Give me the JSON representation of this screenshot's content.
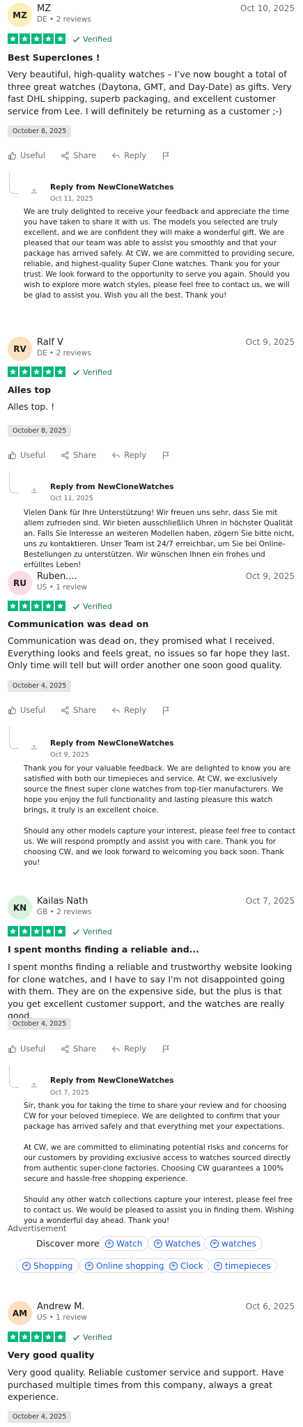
{
  "colors": {
    "star_green": "#00b67a",
    "verified_green": "#1c7a46",
    "link_blue": "#1a5bd8"
  },
  "actions": {
    "useful": "Useful",
    "share": "Share",
    "reply": "Reply"
  },
  "reviews": [
    {
      "initials": "MZ",
      "name": "MZ",
      "meta": "DE • 2 reviews",
      "date": "Oct 10, 2025",
      "rating": 5,
      "verified": "Verified",
      "title": "Best Superclones !",
      "body": "Very beautiful, high-quality watches – I’ve now bought a total of three great watches (Daytona, GMT, and Day-Date) as gifts. Very fast DHL shipping, superb packaging, and excellent customer service from Lee. I will definitely be returning as a customer ;-)",
      "experience_date": "October 8, 2025",
      "reply": {
        "from": "Reply from NewCloneWatches",
        "date": "Oct 11, 2025",
        "paragraphs": [
          "We are truly delighted to receive your feedback and appreciate the time you have taken to share it with us. The models you selected are truly excellent, and we are confident they will make a wonderful gift. We are pleased that our team was able to assist you smoothly and that your package has arrived safely. At CW, we are committed to providing secure, reliable, and highest-quality Super Clone watches. Thank you for your trust. We look forward to the opportunity to serve you again. Should you wish to explore more watch styles, please feel free to contact us, we will be glad to assist you. Wish you all the best. Thank you!"
        ]
      }
    },
    {
      "initials": "RV",
      "name": "Ralf V",
      "meta": "DE • 2 reviews",
      "date": "Oct 9, 2025",
      "rating": 5,
      "verified": "Verified",
      "title": "Alles top",
      "body": "Alles top. !",
      "experience_date": "October 8, 2025",
      "reply": {
        "from": "Reply from NewCloneWatches",
        "date": "Oct 11, 2025",
        "paragraphs": [
          "Vielen Dank für Ihre Unterstützung! Wir freuen uns sehr, dass Sie mit allem zufrieden sind. Wir bieten ausschließlich Uhren in höchster Qualität an. Falls Sie Interesse an weiteren Modellen haben, zögern Sie bitte nicht, uns zu kontaktieren. Unser Team ist 24/7 erreichbar, um Sie bei Online-Bestellungen zu unterstützen. Wir wünschen Ihnen ein frohes und erfülltes Leben!"
        ]
      }
    },
    {
      "initials": "RU",
      "name": "Ruben....",
      "meta": "US • 1 review",
      "date": "Oct 9, 2025",
      "rating": 5,
      "verified": "Verified",
      "title": "Communication was dead on",
      "body": "Communication was dead on, they promised what I received. Everything looks and feels great, no issues so far hope they last. Only time will tell but will order another one soon good quality.",
      "experience_date": "October 4, 2025",
      "reply": {
        "from": "Reply from NewCloneWatches",
        "date": "Oct 9, 2025",
        "paragraphs": [
          "Thank you for your valuable feedback. We are delighted to know you are satisfied with both our timepieces and service. At CW, we exclusively source the finest super clone watches from top-tier manufacturers. We hope you enjoy the full functionality and lasting pleasure this watch brings, it truly is an excellent choice.",
          "Should any other models capture your interest, please feel free to contact us. We will respond promptly and assist you with care. Thank you for choosing CW, and we look forward to welcoming you back soon. Thank you!"
        ]
      }
    },
    {
      "initials": "KN",
      "name": "Kailas Nath",
      "meta": "GB • 2 reviews",
      "date": "Oct 7, 2025",
      "rating": 5,
      "verified": "Verified",
      "title": "I spent months finding a reliable and...",
      "body": "I spent months finding a reliable and trustworthy website looking for clone watches, and I have to say I'm not disappointed going with them. They are on the expensive side, but the plus is that you get excellent customer support, and the watches are really good.",
      "experience_date": "October 4, 2025",
      "reply": {
        "from": "Reply from NewCloneWatches",
        "date": "Oct 7, 2025",
        "paragraphs": [
          "Sir, thank you for taking the time to share your review and for choosing CW for your beloved timepiece. We are delighted to confirm that your package has arrived safely and that everything met your expectations.",
          "At CW, we are committed to eliminating potential risks and concerns for our customers by providing exclusive access to watches sourced directly from authentic super-clone factories. Choosing CW guarantees a 100% secure and hassle-free shopping experience.",
          "Should any other watch collections capture your interest, please feel free to contact us. We would be pleased to assist you in finding them. Wishing you a wonderful day ahead. Thank you!"
        ]
      }
    },
    {
      "initials": "AM",
      "name": "Andrew M.",
      "meta": "US • 1 review",
      "date": "Oct 6, 2025",
      "rating": 5,
      "verified": "Verified",
      "title": "Very good quality",
      "body": "Very good quality. Reliable customer service and support. Have purchased multiple times from this company, always a great experience.",
      "experience_date": "October 4, 2025"
    }
  ],
  "advertisement": {
    "label": "Advertisement",
    "discover": "Discover more",
    "pills": [
      "Watch",
      "Watches",
      "watches",
      "Shopping",
      "Online shopping",
      "Clock",
      "timepieces"
    ]
  }
}
